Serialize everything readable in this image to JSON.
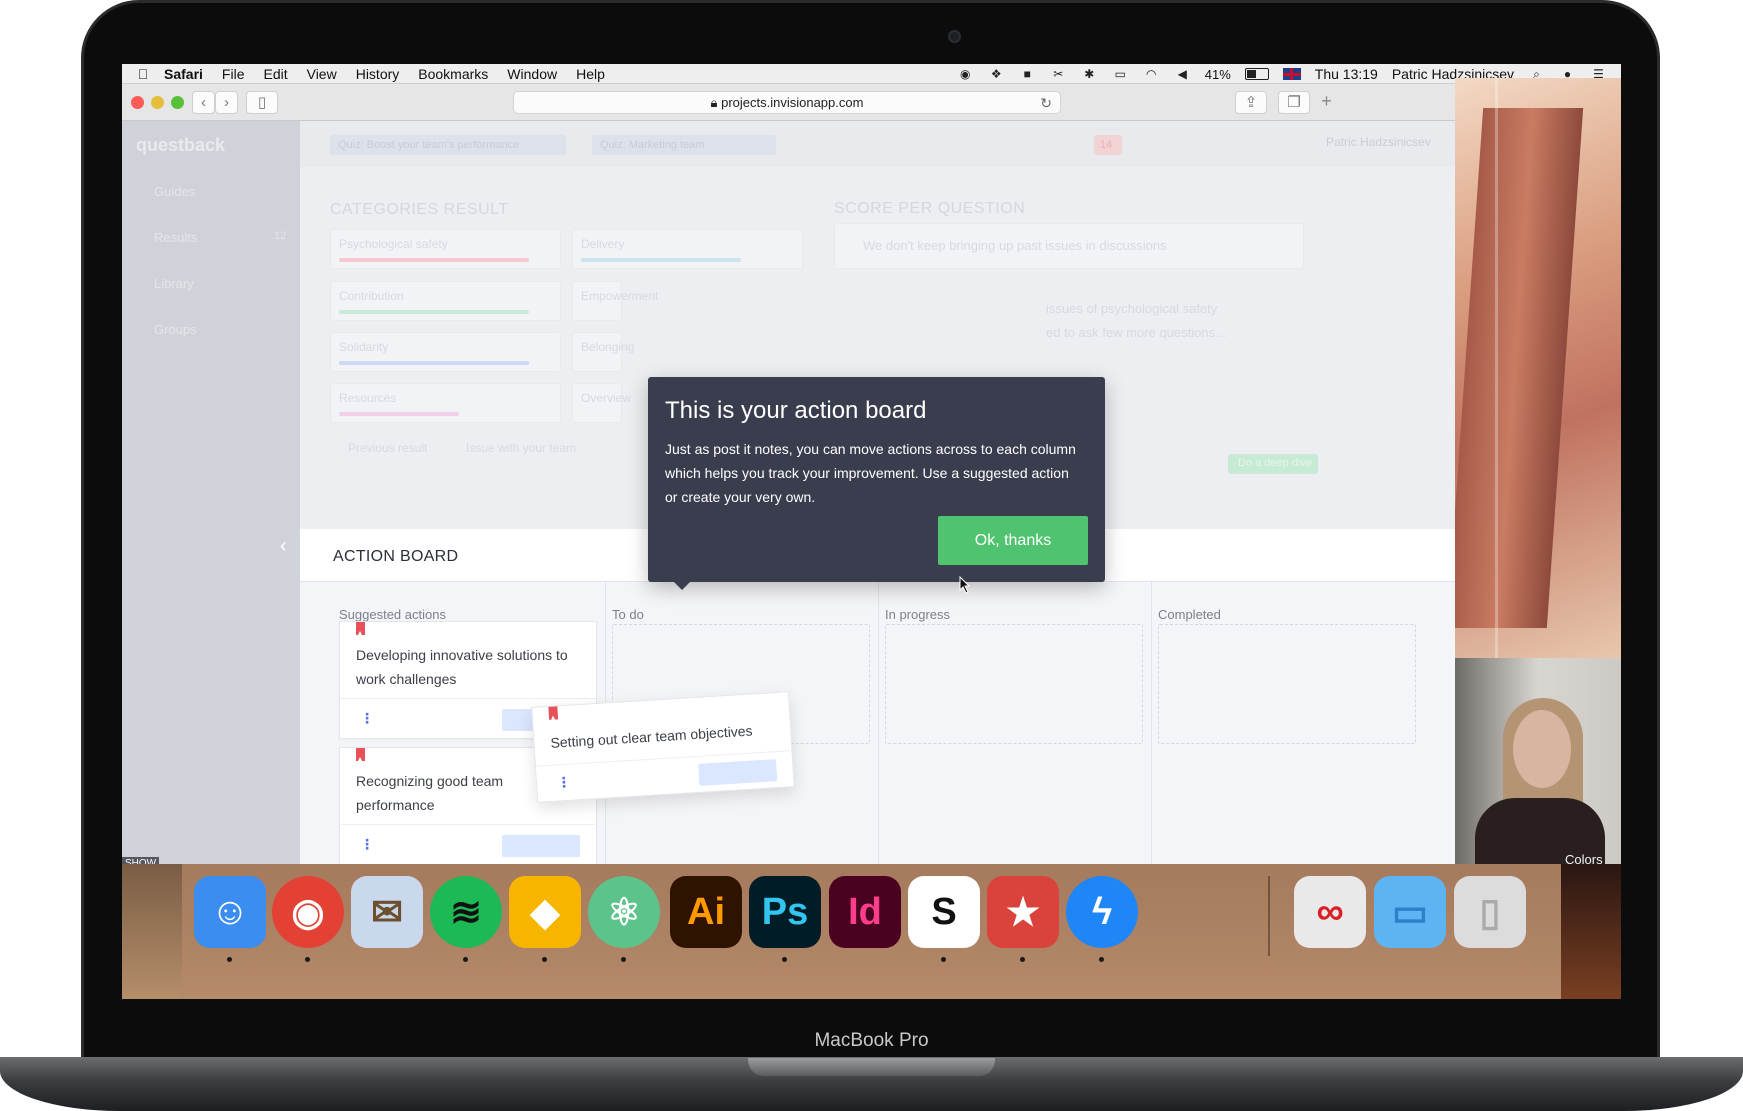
{
  "device": {
    "label": "MacBook Pro"
  },
  "menubar": {
    "app": "Safari",
    "items": [
      "File",
      "Edit",
      "View",
      "History",
      "Bookmarks",
      "Window",
      "Help"
    ],
    "battery": "41%",
    "clock": "Thu 13:19",
    "user": "Patric Hadzsinicsev"
  },
  "browser": {
    "url": "projects.invisionapp.com"
  },
  "app": {
    "brand": "questback",
    "nav": [
      {
        "label": "Guides"
      },
      {
        "label": "Results",
        "badge": "12"
      },
      {
        "label": "Library"
      },
      {
        "label": "Groups"
      }
    ],
    "top_pills": [
      "Quiz: Boost your team's performance",
      "Quiz: Marketing team"
    ],
    "notification_count": "14",
    "user_name": "Patric Hadzsinicsev"
  },
  "background_panel": {
    "categories_title": "CATEGORIES RESULT",
    "score_title": "SCORE PER QUESTION",
    "categories": [
      "Psychological safety",
      "Delivery",
      "Contribution",
      "Empowerment",
      "Solidarity",
      "Belonging",
      "Resources",
      "Overview"
    ],
    "question_text": "We don't keep bringing up past issues in discussions",
    "issues_text": "issues of psychological safety",
    "ask_text": "ed to ask few more questions...",
    "legend": [
      "Previous result",
      "Issue with your team"
    ],
    "green_button": "Do a deep dive"
  },
  "tooltip": {
    "title": "This is your action board",
    "body": "Just as post it notes, you can move actions across to each column which helps you track your improvement. Use a suggested action or create your very own.",
    "button": "Ok, thanks"
  },
  "action_board": {
    "title": "ACTION BOARD",
    "columns": [
      "Suggested actions",
      "To do",
      "In progress",
      "Completed"
    ],
    "cards": [
      {
        "text": "Developing innovative solutions to work challenges"
      },
      {
        "text": "Recognizing good team performance"
      }
    ],
    "dragging_card": {
      "text": "Setting out clear team objectives"
    }
  },
  "video": {
    "show_label": "SHOW",
    "caption": "Colors"
  },
  "dock": {
    "icons": [
      {
        "name": "finder",
        "glyph": "☺",
        "bg": "#3b8ef0"
      },
      {
        "name": "chrome",
        "glyph": "◉",
        "bg": "#e34133"
      },
      {
        "name": "preview",
        "glyph": "✉",
        "bg": "#c9d8ec"
      },
      {
        "name": "spotify",
        "glyph": "≋",
        "bg": "#1db954"
      },
      {
        "name": "sketch",
        "glyph": "◆",
        "bg": "#f7b500"
      },
      {
        "name": "atom",
        "glyph": "⚛",
        "bg": "#5cc48b"
      },
      {
        "name": "illustrator",
        "glyph": "Ai",
        "bg": "#2e1300"
      },
      {
        "name": "photoshop",
        "glyph": "Ps",
        "bg": "#001c26"
      },
      {
        "name": "indesign",
        "glyph": "Id",
        "bg": "#49021f"
      },
      {
        "name": "slack",
        "glyph": "S",
        "bg": "#ffffff"
      },
      {
        "name": "wunderlist",
        "glyph": "★",
        "bg": "#d9433c"
      },
      {
        "name": "messenger",
        "glyph": "ϟ",
        "bg": "#1e86f7"
      },
      {
        "name": "creative-cloud",
        "glyph": "∞",
        "bg": "#e9e9e9"
      },
      {
        "name": "folder",
        "glyph": "▭",
        "bg": "#5eb4f2"
      },
      {
        "name": "trash",
        "glyph": "▯",
        "bg": "#dcdcdc"
      }
    ]
  },
  "colors": {
    "accent_green": "#4fc36f",
    "tooltip_bg": "#3a3d4e",
    "bookmark_red": "#e8515a"
  }
}
